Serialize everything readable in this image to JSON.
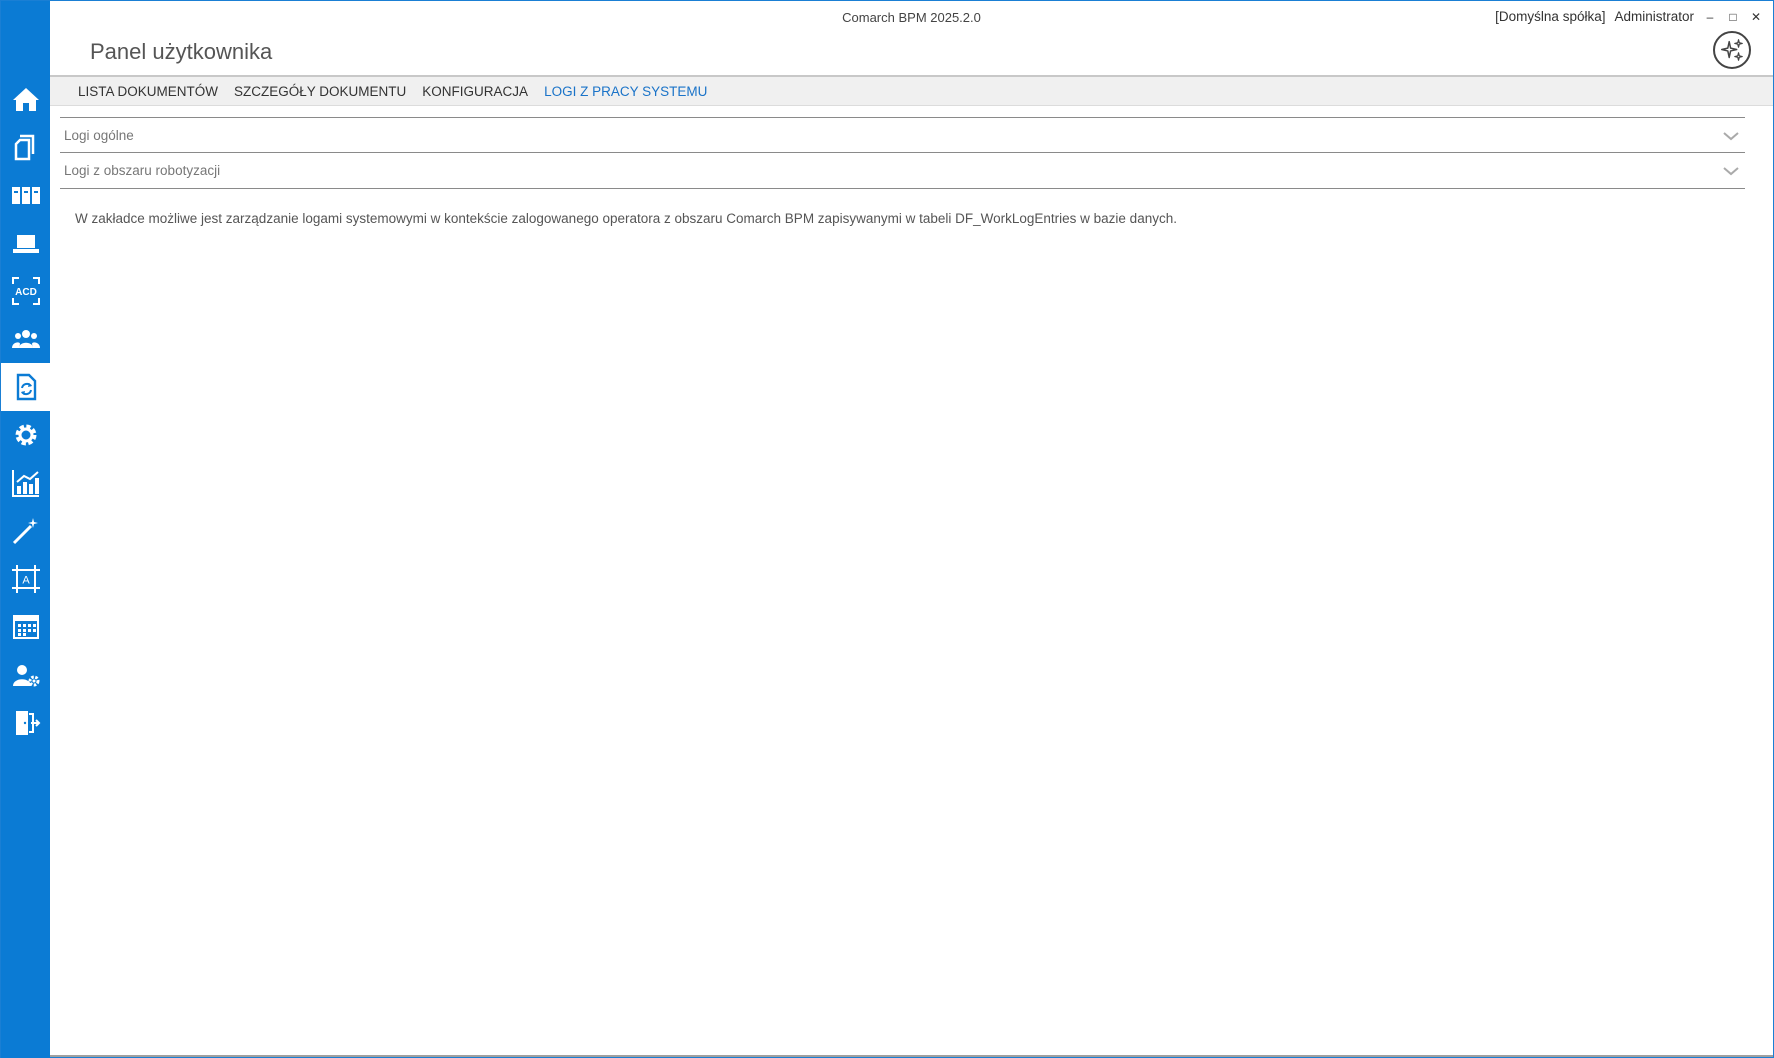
{
  "window": {
    "app_title": "Comarch BPM 2025.2.0",
    "company": "[Domyślna spółka]",
    "user": "Administrator",
    "minimize": "‒",
    "maximize": "□",
    "close": "✕"
  },
  "page": {
    "title": "Panel użytkownika"
  },
  "tabs": [
    {
      "label": "LISTA DOKUMENTÓW",
      "active": false
    },
    {
      "label": "SZCZEGÓŁY DOKUMENTU",
      "active": false
    },
    {
      "label": "KONFIGURACJA",
      "active": false
    },
    {
      "label": "LOGI Z PRACY SYSTEMU",
      "active": true
    }
  ],
  "sections": [
    {
      "label": "Logi ogólne"
    },
    {
      "label": "Logi z obszaru robotyzacji"
    }
  ],
  "info": {
    "text": "W zakładce możliwe jest zarządzanie logami systemowymi w kontekście zalogowanego operatora z obszaru Comarch BPM zapisywanymi w tabeli DF_WorkLogEntries w bazie danych."
  },
  "sidebar": {
    "icon_text": "ACD",
    "form_icon_text": "A",
    "items": [
      {
        "icon": "home-icon"
      },
      {
        "icon": "documents-icon"
      },
      {
        "icon": "binders-icon"
      },
      {
        "icon": "laptop-icon"
      },
      {
        "icon": "acd-scan-icon"
      },
      {
        "icon": "users-group-icon"
      },
      {
        "icon": "document-sync-icon",
        "active": true
      },
      {
        "icon": "gear-icon"
      },
      {
        "icon": "chart-icon"
      },
      {
        "icon": "magic-wand-icon"
      },
      {
        "icon": "form-designer-icon"
      },
      {
        "icon": "calendar-icon"
      },
      {
        "icon": "user-settings-icon"
      },
      {
        "icon": "logout-icon"
      }
    ]
  },
  "colors": {
    "sidebar": "#0b7bd4",
    "active_tab": "#1a73c8"
  }
}
